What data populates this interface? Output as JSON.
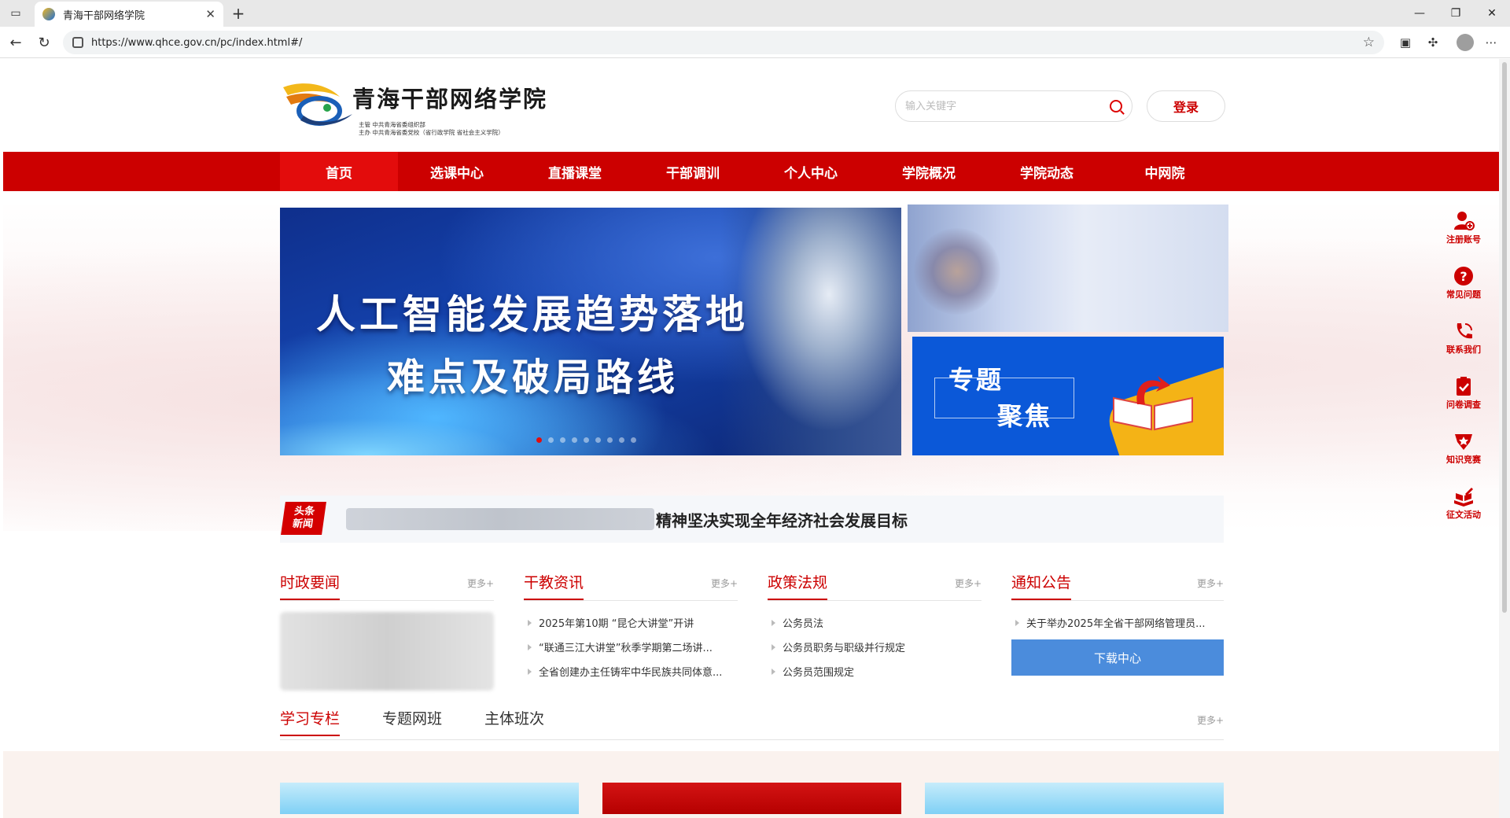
{
  "browser": {
    "tab_title": "青海干部网络学院",
    "url": "https://www.qhce.gov.cn/pc/index.html#/"
  },
  "site": {
    "logo_title": "青海干部网络学院",
    "logo_sub1": "主管  中共青海省委组织部",
    "logo_sub2": "主办  中共青海省委党校（省行政学院 省社会主义学院）",
    "search_placeholder": "输入关键字",
    "login_label": "登录"
  },
  "nav": {
    "items": [
      "首页",
      "选课中心",
      "直播课堂",
      "干部调训",
      "个人中心",
      "学院概况",
      "学院动态",
      "中网院"
    ]
  },
  "banner": {
    "line1": "人工智能发展趋势落地",
    "line2": "难点及破局路线"
  },
  "focus": {
    "t1": "专题",
    "t2": "聚焦"
  },
  "side_tools": [
    "注册账号",
    "常见问题",
    "联系我们",
    "问卷调查",
    "知识竞赛",
    "征文活动"
  ],
  "headline": {
    "badge1": "头条",
    "badge2": "新闻",
    "text": "精神坚决实现全年经济社会发展目标"
  },
  "columns": [
    {
      "title": "时政要闻",
      "more": "更多+",
      "items": []
    },
    {
      "title": "干教资讯",
      "more": "更多+",
      "items": [
        "2025年第10期 “昆仑大讲堂”开讲",
        "“联通三江大讲堂”秋季学期第二场讲...",
        "全省创建办主任铸牢中华民族共同体意..."
      ]
    },
    {
      "title": "政策法规",
      "more": "更多+",
      "items": [
        "公务员法",
        "公务员职务与职级并行规定",
        "公务员范围规定"
      ]
    },
    {
      "title": "通知公告",
      "more": "更多+",
      "items": [
        "关于举办2025年全省干部网络管理员..."
      ],
      "download_label": "下载中心"
    }
  ],
  "study": {
    "tabs": [
      "学习专栏",
      "专题网班",
      "主体班次"
    ],
    "more": "更多+"
  },
  "colors": {
    "brand_red": "#cc0000",
    "download_blue": "#4b8cdc",
    "focus_blue": "#0b58d8"
  }
}
